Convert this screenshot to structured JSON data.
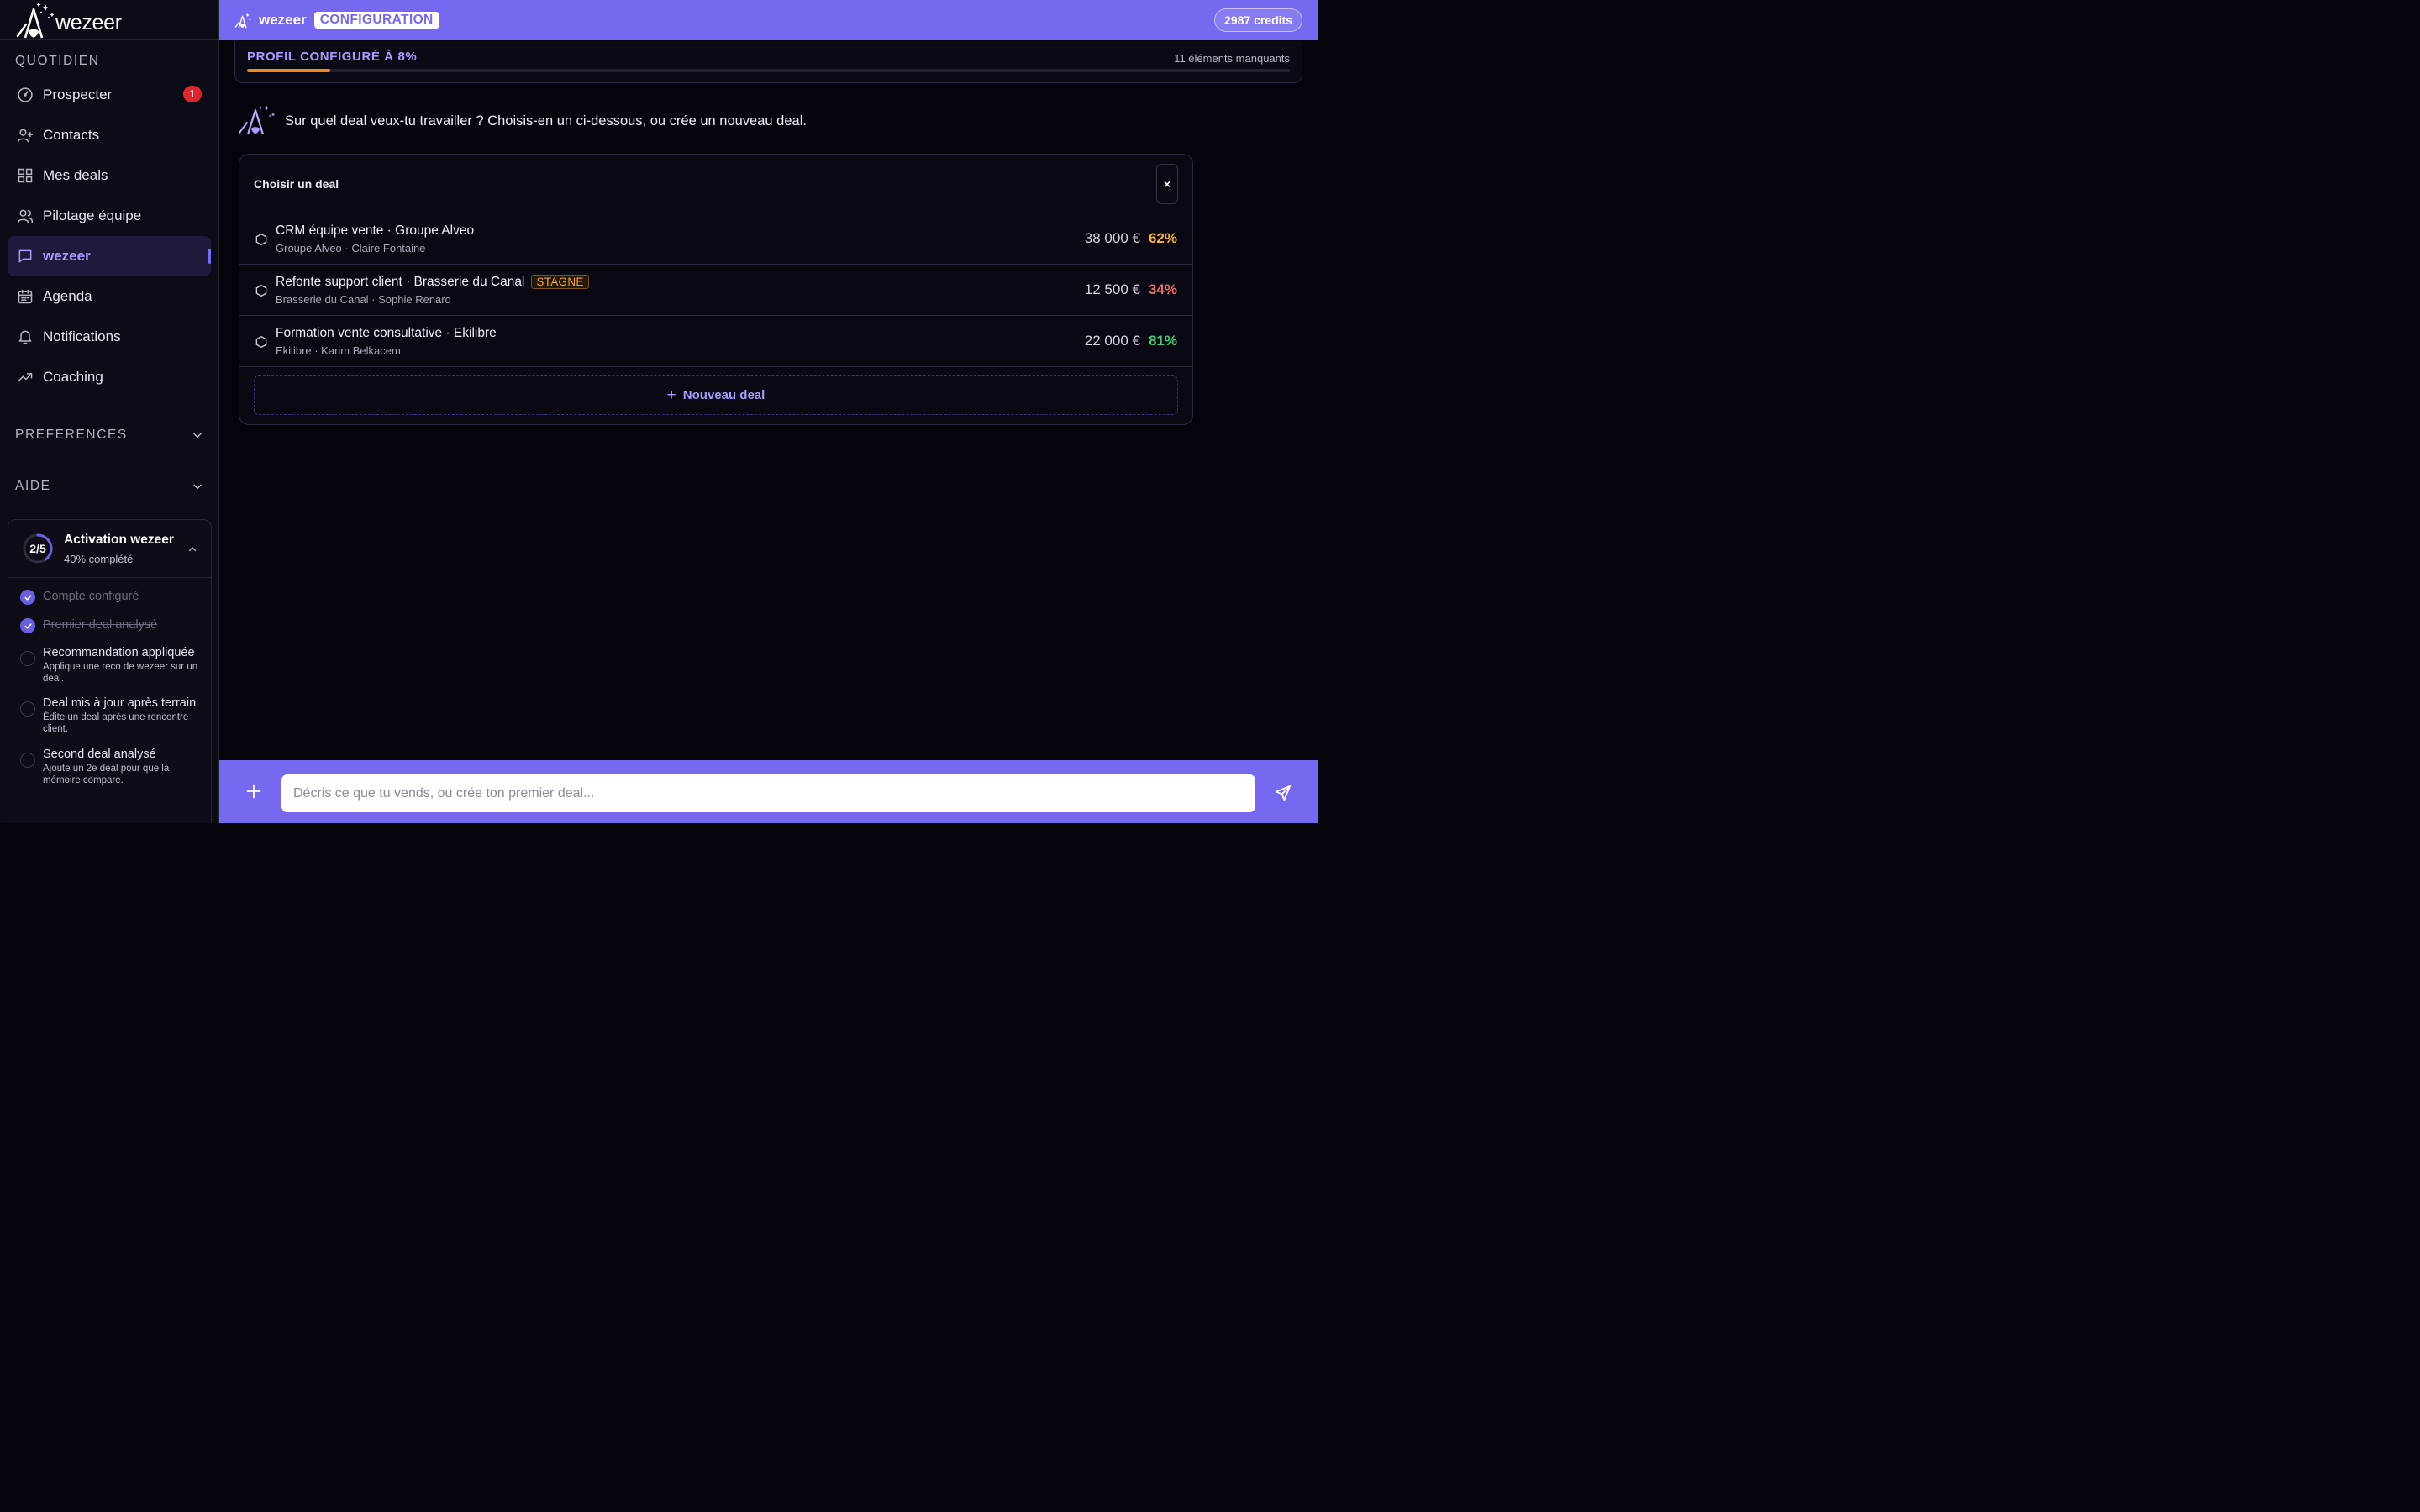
{
  "app": {
    "logo_text": "wezeer"
  },
  "sidebar": {
    "section_daily": "QUOTIDIEN",
    "items": [
      {
        "label": "Prospecter",
        "icon": "gauge-icon",
        "badge": "1"
      },
      {
        "label": "Contacts",
        "icon": "user-plus-icon"
      },
      {
        "label": "Mes deals",
        "icon": "grid-icon"
      },
      {
        "label": "Pilotage équipe",
        "icon": "users-icon"
      },
      {
        "label": "wezeer",
        "icon": "chat-icon",
        "active": true
      },
      {
        "label": "Agenda",
        "icon": "calendar-icon"
      },
      {
        "label": "Notifications",
        "icon": "bell-icon"
      },
      {
        "label": "Coaching",
        "icon": "trending-up-icon"
      }
    ],
    "section_preferences": "PREFERENCES",
    "section_help": "AIDE",
    "activation": {
      "ring_label": "2/5",
      "progress_fraction": 0.4,
      "title": "Activation wezeer",
      "subtitle": "40% complété",
      "steps": [
        {
          "label": "Compte configuré",
          "done": true,
          "desc": ""
        },
        {
          "label": "Premier deal analysé",
          "done": true,
          "desc": ""
        },
        {
          "label": "Recommandation appliquée",
          "done": false,
          "desc": "Applique une reco de wezeer sur un deal."
        },
        {
          "label": "Deal mis à jour après terrain",
          "done": false,
          "desc": "Édite un deal après une rencontre client."
        },
        {
          "label": "Second deal analysé",
          "done": false,
          "desc": "Ajoute un 2e deal pour que la mémoire compare."
        }
      ]
    }
  },
  "topbar": {
    "brand": "wezeer",
    "tag": "CONFIGURATION",
    "credits": "2987 credits"
  },
  "profile": {
    "title": "PROFIL CONFIGURÉ À 8%",
    "missing": "11 éléments manquants",
    "progress_percent": 8
  },
  "assistant": {
    "message": "Sur quel deal veux-tu travailler ? Choisis-en un ci-dessous, ou crée un nouveau deal."
  },
  "deal_picker": {
    "title": "Choisir un deal",
    "close_label": "×",
    "deals": [
      {
        "name": "CRM équipe vente · Groupe Alveo",
        "sub": "Groupe Alveo · Claire Fontaine",
        "amount": "38 000 €",
        "pct": "62%",
        "pct_color": "#f4b23a",
        "tag": ""
      },
      {
        "name": "Refonte support client · Brasserie du Canal",
        "sub": "Brasserie du Canal · Sophie Renard",
        "amount": "12 500 €",
        "pct": "34%",
        "pct_color": "#f06b6b",
        "tag": "STAGNE"
      },
      {
        "name": "Formation vente consultative · Ekilibre",
        "sub": "Ekilibre · Karim Belkacem",
        "amount": "22 000 €",
        "pct": "81%",
        "pct_color": "#3fcf73",
        "tag": ""
      }
    ],
    "new_deal_label": "Nouveau deal"
  },
  "composer": {
    "placeholder": "Décris ce que tu vends, ou crée ton premier deal..."
  },
  "colors": {
    "accent": "#7669f0",
    "accent_light": "#a89cff",
    "progress_orange": "#f08a1c",
    "badge_red": "#e0262d"
  }
}
